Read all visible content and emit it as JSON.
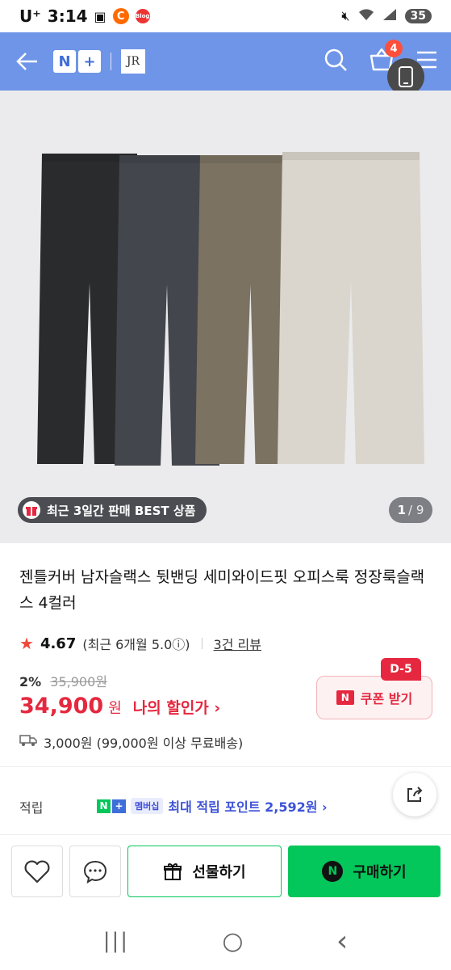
{
  "status_bar": {
    "carrier": "U⁺",
    "time": "3:14",
    "notif_badge": "C",
    "notif_blog": "Blog",
    "battery": "35"
  },
  "navbar": {
    "logo_n": "N",
    "logo_plus": "+",
    "brand": "JR",
    "cart_count": "4"
  },
  "hero": {
    "best_label": "최근 3일간 판매 BEST 상품",
    "page_current": "1",
    "page_total": "/ 9",
    "pants_colors": [
      "#2a2b2d",
      "#43464d",
      "#7b7262",
      "#dbd6cd"
    ]
  },
  "product": {
    "title": "젠틀커버 남자슬랙스 뒷밴딩 세미와이드핏 오피스룩 정장룩슬랙스 4컬러",
    "rating": "4.67",
    "rating_detail": "(최근 6개월 5.0ⓘ)",
    "review_count": "3건 리뷰",
    "discount": "2%",
    "original_price": "35,900원",
    "price": "34,900",
    "price_unit": "원",
    "my_discount": "나의 할인가 ›",
    "coupon_label": "쿠폰 받기",
    "coupon_icon": "N",
    "dday": "D-5",
    "shipping": "3,000원 (99,000원 이상 무료배송)"
  },
  "points": {
    "label": "적립",
    "membership": "멤버십",
    "text": "최대 적립 포인트 2,592원 ›"
  },
  "actions": {
    "gift_label": "선물하기",
    "buy_label": "구매하기",
    "buy_icon": "N"
  },
  "system_nav": {
    "recent": "|||",
    "home": "○",
    "back": "‹"
  }
}
